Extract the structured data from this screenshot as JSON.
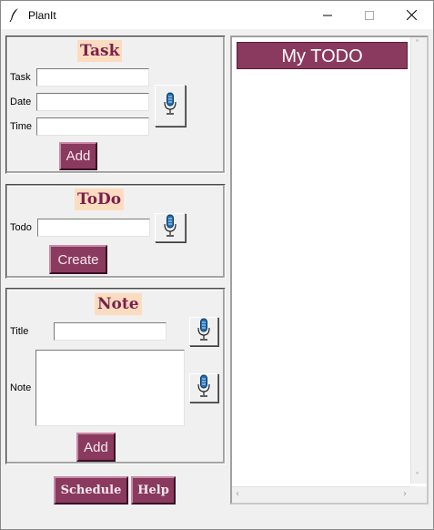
{
  "window": {
    "title": "PlanIt"
  },
  "task": {
    "heading": "Task",
    "task_label": "Task",
    "date_label": "Date",
    "time_label": "Time",
    "task_value": "",
    "date_value": "",
    "time_value": "",
    "add_label": "Add"
  },
  "todo": {
    "heading": "ToDo",
    "todo_label": "Todo",
    "todo_value": "",
    "create_label": "Create"
  },
  "note": {
    "heading": "Note",
    "title_label": "Title",
    "note_label": "Note",
    "title_value": "",
    "note_value": "",
    "add_label": "Add"
  },
  "footer": {
    "schedule_label": "Schedule",
    "help_label": "Help"
  },
  "todo_list": {
    "title": "My TODO",
    "items": []
  },
  "colors": {
    "button_bg": "#8a3a5e",
    "heading_bg": "#fcdcc0",
    "heading_fg": "#7a1f4a",
    "mic_blue": "#1f6fb5"
  },
  "icons": {
    "app": "feather-icon",
    "mic": "microphone-icon"
  }
}
